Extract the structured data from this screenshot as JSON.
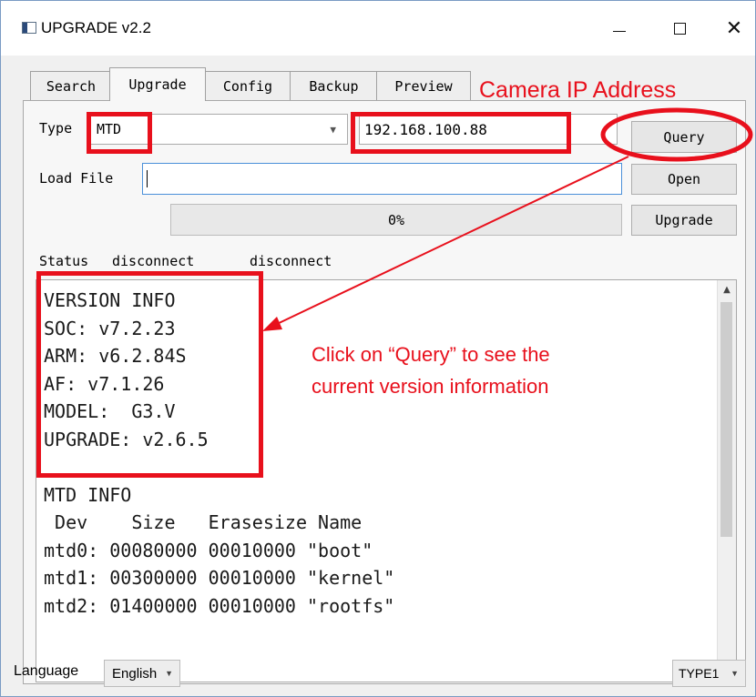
{
  "window": {
    "title": "UPGRADE v2.2",
    "controls": {
      "minimize": "—",
      "maximize": "☐",
      "close": "✕"
    }
  },
  "tabs": [
    {
      "label": "Search",
      "active": false
    },
    {
      "label": "Upgrade",
      "active": true
    },
    {
      "label": "Config",
      "active": false
    },
    {
      "label": "Backup",
      "active": false
    },
    {
      "label": "Preview",
      "active": false
    }
  ],
  "form": {
    "type_label": "Type",
    "type_value": "MTD",
    "ip_value": "192.168.100.88",
    "query_button": "Query",
    "load_file_label": "Load File",
    "load_file_value": "",
    "open_button": "Open",
    "progress_text": "0%",
    "progress_value": 0,
    "upgrade_button": "Upgrade",
    "status_label": "Status",
    "status_value_1": "disconnect",
    "status_value_2": "disconnect"
  },
  "log": {
    "lines": [
      "VERSION INFO",
      "SOC: v7.2.23",
      "ARM: v6.2.84S",
      "AF: v7.1.26",
      "MODEL:  G3.V",
      "UPGRADE: v2.6.5",
      "",
      "MTD INFO",
      " Dev    Size   Erasesize Name",
      "mtd0: 00080000 00010000 \"boot\"",
      "mtd1: 00300000 00010000 \"kernel\"",
      "mtd2: 01400000 00010000 \"rootfs\""
    ]
  },
  "footer": {
    "language_label": "Language",
    "language_value": "English",
    "type_value": "TYPE1"
  },
  "annotations": {
    "camera_ip_label": "Camera IP Address",
    "query_hint_line1": "Click on “Query” to see the",
    "query_hint_line2": "current version information",
    "color": "#e8101c"
  },
  "icons": {
    "app": "app-window-icon",
    "combo_arrow": "chevron-down-icon",
    "scroll_up": "triangle-up-icon",
    "scroll_down": "triangle-down-icon"
  }
}
